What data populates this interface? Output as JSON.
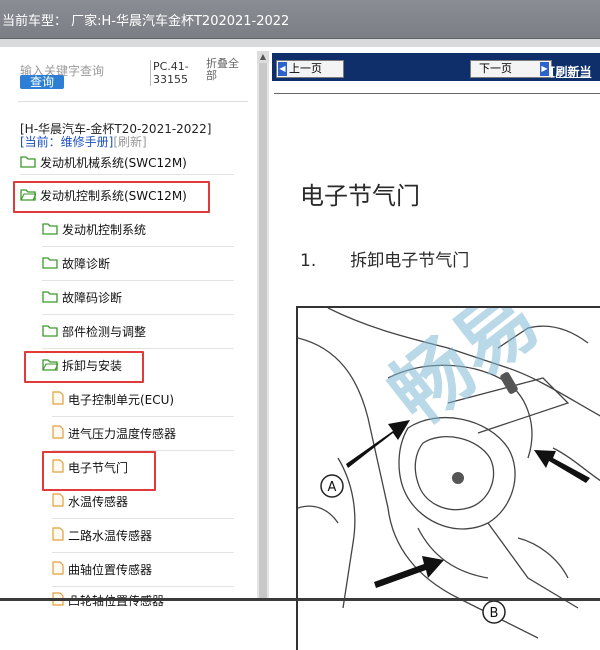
{
  "window": {
    "caption": "当前车型： 厂家:H-华晨汽车金杯T202021-2022"
  },
  "search": {
    "placeholder": "输入关键字查询",
    "button_label": "查询",
    "pc_code": "PC.41-33155",
    "collapse_label": "折叠全部"
  },
  "tree": {
    "root_title": "[H-华晨汽车-金杯T20-2021-2022]",
    "current_label": "[当前：维修手册]",
    "refresh_label": "[刷新]",
    "items": [
      {
        "label": "发动机机械系统(SWC12M)",
        "type": "folder"
      },
      {
        "label": "发动机控制系统(SWC12M)",
        "type": "folder-open"
      },
      {
        "label": "发动机控制系统",
        "type": "folder"
      },
      {
        "label": "故障诊断",
        "type": "folder"
      },
      {
        "label": "故障码诊断",
        "type": "folder"
      },
      {
        "label": "部件检测与调整",
        "type": "folder"
      },
      {
        "label": "拆卸与安装",
        "type": "folder-open"
      },
      {
        "label": "电子控制单元(ECU)",
        "type": "doc"
      },
      {
        "label": "进气压力温度传感器",
        "type": "doc"
      },
      {
        "label": "电子节气门",
        "type": "doc"
      },
      {
        "label": "水温传感器",
        "type": "doc"
      },
      {
        "label": "二路水温传感器",
        "type": "doc"
      },
      {
        "label": "曲轴位置传感器",
        "type": "doc"
      },
      {
        "label": "凸轮轴位置传感器",
        "type": "doc"
      }
    ]
  },
  "nav": {
    "prev_label": "上一页",
    "next_label": "下一页",
    "refresh_label": "[刷新当"
  },
  "document": {
    "title": "电子节气门",
    "step_number": "1.",
    "step_text": "拆卸电子节气门",
    "figure_labels": [
      "A",
      "B"
    ],
    "watermark": "畅易"
  },
  "colors": {
    "nav_bg": "#0f2f6b",
    "highlight": "#e03a3a",
    "folder_green": "#3a9a2a",
    "doc_orange": "#e0a040",
    "search_button": "#2d7fd6"
  }
}
